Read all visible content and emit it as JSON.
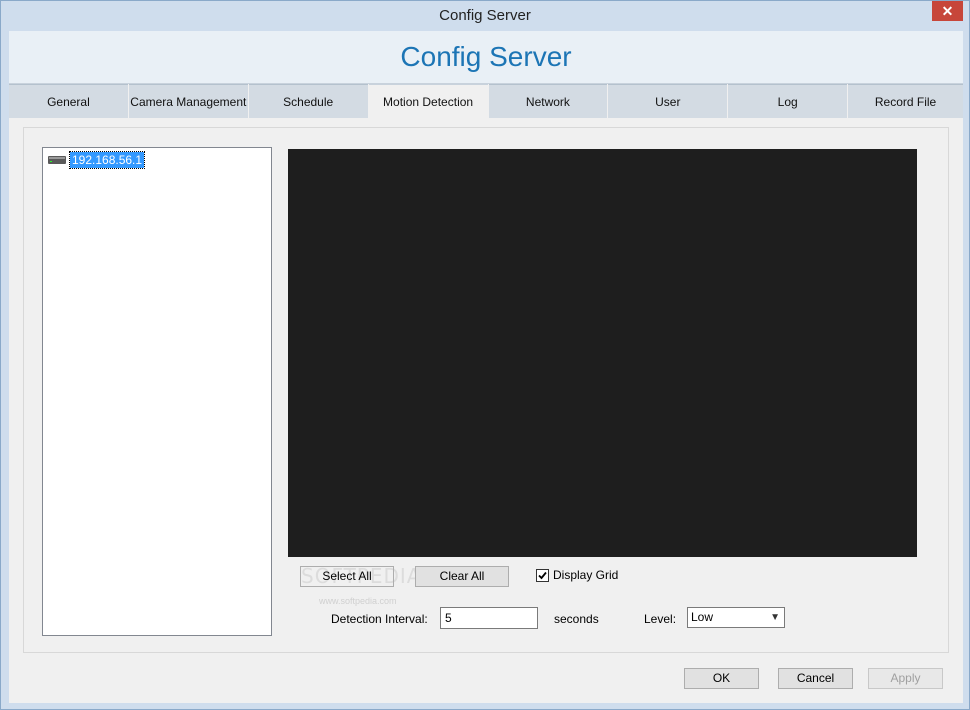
{
  "window": {
    "title": "Config Server"
  },
  "banner": {
    "title": "Config Server"
  },
  "tabs": [
    {
      "label": "General"
    },
    {
      "label": "Camera Management"
    },
    {
      "label": "Schedule"
    },
    {
      "label": "Motion Detection"
    },
    {
      "label": "Network"
    },
    {
      "label": "User"
    },
    {
      "label": "Log"
    },
    {
      "label": "Record File"
    }
  ],
  "active_tab": "Motion Detection",
  "tree": {
    "items": [
      {
        "label": "192.168.56.1",
        "icon": "server-icon",
        "selected": true
      }
    ]
  },
  "controls": {
    "select_all_label": "Select All",
    "clear_all_label": "Clear All",
    "display_grid_label": "Display Grid",
    "display_grid_checked": true,
    "detection_interval_label": "Detection Interval:",
    "detection_interval_value": "5",
    "seconds_label": "seconds",
    "level_label": "Level:",
    "level_value": "Low"
  },
  "footer": {
    "ok_label": "OK",
    "cancel_label": "Cancel",
    "apply_label": "Apply"
  },
  "watermark": {
    "text": "SOFTPEDIA",
    "sub": "www.softpedia.com"
  },
  "colors": {
    "accent": "#1c75b5",
    "selection": "#3399ff",
    "video_bg": "#1e1e1e"
  }
}
